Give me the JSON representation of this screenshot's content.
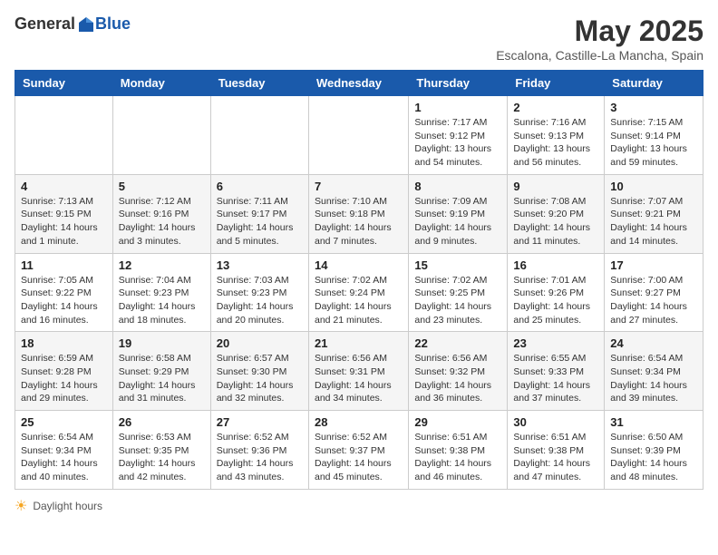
{
  "header": {
    "logo_general": "General",
    "logo_blue": "Blue",
    "month": "May 2025",
    "location": "Escalona, Castille-La Mancha, Spain"
  },
  "days_of_week": [
    "Sunday",
    "Monday",
    "Tuesday",
    "Wednesday",
    "Thursday",
    "Friday",
    "Saturday"
  ],
  "weeks": [
    [
      {
        "day": "",
        "info": ""
      },
      {
        "day": "",
        "info": ""
      },
      {
        "day": "",
        "info": ""
      },
      {
        "day": "",
        "info": ""
      },
      {
        "day": "1",
        "info": "Sunrise: 7:17 AM\nSunset: 9:12 PM\nDaylight: 13 hours and 54 minutes."
      },
      {
        "day": "2",
        "info": "Sunrise: 7:16 AM\nSunset: 9:13 PM\nDaylight: 13 hours and 56 minutes."
      },
      {
        "day": "3",
        "info": "Sunrise: 7:15 AM\nSunset: 9:14 PM\nDaylight: 13 hours and 59 minutes."
      }
    ],
    [
      {
        "day": "4",
        "info": "Sunrise: 7:13 AM\nSunset: 9:15 PM\nDaylight: 14 hours and 1 minute."
      },
      {
        "day": "5",
        "info": "Sunrise: 7:12 AM\nSunset: 9:16 PM\nDaylight: 14 hours and 3 minutes."
      },
      {
        "day": "6",
        "info": "Sunrise: 7:11 AM\nSunset: 9:17 PM\nDaylight: 14 hours and 5 minutes."
      },
      {
        "day": "7",
        "info": "Sunrise: 7:10 AM\nSunset: 9:18 PM\nDaylight: 14 hours and 7 minutes."
      },
      {
        "day": "8",
        "info": "Sunrise: 7:09 AM\nSunset: 9:19 PM\nDaylight: 14 hours and 9 minutes."
      },
      {
        "day": "9",
        "info": "Sunrise: 7:08 AM\nSunset: 9:20 PM\nDaylight: 14 hours and 11 minutes."
      },
      {
        "day": "10",
        "info": "Sunrise: 7:07 AM\nSunset: 9:21 PM\nDaylight: 14 hours and 14 minutes."
      }
    ],
    [
      {
        "day": "11",
        "info": "Sunrise: 7:05 AM\nSunset: 9:22 PM\nDaylight: 14 hours and 16 minutes."
      },
      {
        "day": "12",
        "info": "Sunrise: 7:04 AM\nSunset: 9:23 PM\nDaylight: 14 hours and 18 minutes."
      },
      {
        "day": "13",
        "info": "Sunrise: 7:03 AM\nSunset: 9:23 PM\nDaylight: 14 hours and 20 minutes."
      },
      {
        "day": "14",
        "info": "Sunrise: 7:02 AM\nSunset: 9:24 PM\nDaylight: 14 hours and 21 minutes."
      },
      {
        "day": "15",
        "info": "Sunrise: 7:02 AM\nSunset: 9:25 PM\nDaylight: 14 hours and 23 minutes."
      },
      {
        "day": "16",
        "info": "Sunrise: 7:01 AM\nSunset: 9:26 PM\nDaylight: 14 hours and 25 minutes."
      },
      {
        "day": "17",
        "info": "Sunrise: 7:00 AM\nSunset: 9:27 PM\nDaylight: 14 hours and 27 minutes."
      }
    ],
    [
      {
        "day": "18",
        "info": "Sunrise: 6:59 AM\nSunset: 9:28 PM\nDaylight: 14 hours and 29 minutes."
      },
      {
        "day": "19",
        "info": "Sunrise: 6:58 AM\nSunset: 9:29 PM\nDaylight: 14 hours and 31 minutes."
      },
      {
        "day": "20",
        "info": "Sunrise: 6:57 AM\nSunset: 9:30 PM\nDaylight: 14 hours and 32 minutes."
      },
      {
        "day": "21",
        "info": "Sunrise: 6:56 AM\nSunset: 9:31 PM\nDaylight: 14 hours and 34 minutes."
      },
      {
        "day": "22",
        "info": "Sunrise: 6:56 AM\nSunset: 9:32 PM\nDaylight: 14 hours and 36 minutes."
      },
      {
        "day": "23",
        "info": "Sunrise: 6:55 AM\nSunset: 9:33 PM\nDaylight: 14 hours and 37 minutes."
      },
      {
        "day": "24",
        "info": "Sunrise: 6:54 AM\nSunset: 9:34 PM\nDaylight: 14 hours and 39 minutes."
      }
    ],
    [
      {
        "day": "25",
        "info": "Sunrise: 6:54 AM\nSunset: 9:34 PM\nDaylight: 14 hours and 40 minutes."
      },
      {
        "day": "26",
        "info": "Sunrise: 6:53 AM\nSunset: 9:35 PM\nDaylight: 14 hours and 42 minutes."
      },
      {
        "day": "27",
        "info": "Sunrise: 6:52 AM\nSunset: 9:36 PM\nDaylight: 14 hours and 43 minutes."
      },
      {
        "day": "28",
        "info": "Sunrise: 6:52 AM\nSunset: 9:37 PM\nDaylight: 14 hours and 45 minutes."
      },
      {
        "day": "29",
        "info": "Sunrise: 6:51 AM\nSunset: 9:38 PM\nDaylight: 14 hours and 46 minutes."
      },
      {
        "day": "30",
        "info": "Sunrise: 6:51 AM\nSunset: 9:38 PM\nDaylight: 14 hours and 47 minutes."
      },
      {
        "day": "31",
        "info": "Sunrise: 6:50 AM\nSunset: 9:39 PM\nDaylight: 14 hours and 48 minutes."
      }
    ]
  ],
  "footer": {
    "daylight_label": "Daylight hours"
  }
}
